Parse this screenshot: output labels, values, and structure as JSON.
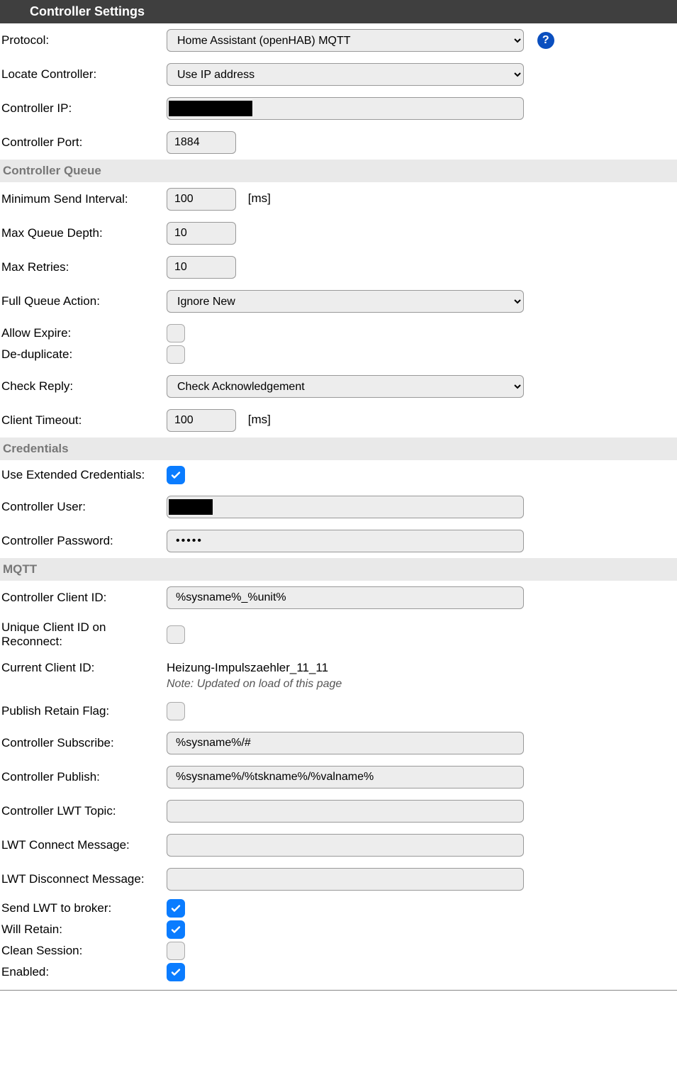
{
  "header": {
    "title": "Controller Settings"
  },
  "top": {
    "protocol_label": "Protocol:",
    "protocol_value": "Home Assistant (openHAB) MQTT",
    "help_glyph": "?",
    "locate_label": "Locate Controller:",
    "locate_value": "Use IP address",
    "ip_label": "Controller IP:",
    "port_label": "Controller Port:",
    "port_value": "1884"
  },
  "queue": {
    "section": "Controller Queue",
    "min_interval_label": "Minimum Send Interval:",
    "min_interval_value": "100",
    "ms": "[ms]",
    "max_depth_label": "Max Queue Depth:",
    "max_depth_value": "10",
    "max_retries_label": "Max Retries:",
    "max_retries_value": "10",
    "full_action_label": "Full Queue Action:",
    "full_action_value": "Ignore New",
    "allow_expire_label": "Allow Expire:",
    "dedup_label": "De-duplicate:",
    "check_reply_label": "Check Reply:",
    "check_reply_value": "Check Acknowledgement",
    "client_timeout_label": "Client Timeout:",
    "client_timeout_value": "100"
  },
  "creds": {
    "section": "Credentials",
    "ext_label": "Use Extended Credentials:",
    "user_label": "Controller User:",
    "pass_label": "Controller Password:",
    "pass_value": "•••••"
  },
  "mqtt": {
    "section": "MQTT",
    "client_id_label": "Controller Client ID:",
    "client_id_value": "%sysname%_%unit%",
    "unique_label_1": "Unique Client ID on",
    "unique_label_2": "Reconnect:",
    "current_id_label": "Current Client ID:",
    "current_id_value": "Heizung-Impulszaehler_11_11",
    "note": "Note: Updated on load of this page",
    "retain_label": "Publish Retain Flag:",
    "sub_label": "Controller Subscribe:",
    "sub_value": "%sysname%/#",
    "pub_label": "Controller Publish:",
    "pub_value": "%sysname%/%tskname%/%valname%",
    "lwt_topic_label": "Controller LWT Topic:",
    "lwt_topic_value": "",
    "lwt_conn_label": "LWT Connect Message:",
    "lwt_conn_value": "",
    "lwt_disc_label": "LWT Disconnect Message:",
    "lwt_disc_value": "",
    "send_lwt_label": "Send LWT to broker:",
    "will_retain_label": "Will Retain:",
    "clean_label": "Clean Session:",
    "enabled_label": "Enabled:"
  }
}
